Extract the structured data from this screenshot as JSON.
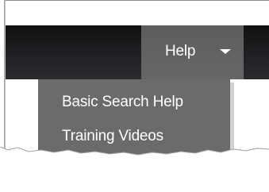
{
  "header": {
    "help_menu": {
      "label": "Help",
      "icon": "chevron-down-icon",
      "expanded": true
    }
  },
  "dropdown": {
    "items": [
      {
        "label": "Basic Search Help"
      },
      {
        "label": "Training Videos"
      }
    ]
  },
  "colors": {
    "header_background": "#1d1e21",
    "active_tab": "#5d5d5d",
    "dropdown_background": "#6b6b6b",
    "menu_text": "#ffffff",
    "page_background": "#ffffff"
  }
}
